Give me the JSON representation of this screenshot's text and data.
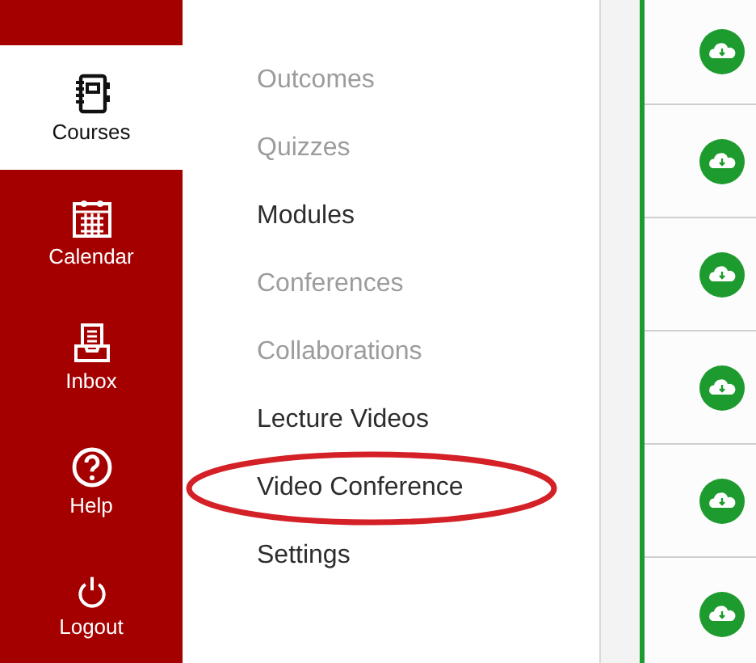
{
  "global_nav": [
    {
      "label": "Courses",
      "selected": true
    },
    {
      "label": "Calendar",
      "selected": false
    },
    {
      "label": "Inbox",
      "selected": false
    },
    {
      "label": "Help",
      "selected": false
    },
    {
      "label": "Logout",
      "selected": false
    }
  ],
  "course_nav": [
    {
      "label": "Outcomes",
      "disabled": true,
      "circled": false
    },
    {
      "label": "Quizzes",
      "disabled": true,
      "circled": false
    },
    {
      "label": "Modules",
      "disabled": false,
      "circled": false
    },
    {
      "label": "Conferences",
      "disabled": true,
      "circled": false
    },
    {
      "label": "Collaborations",
      "disabled": true,
      "circled": false
    },
    {
      "label": "Lecture Videos",
      "disabled": false,
      "circled": false
    },
    {
      "label": "Video Conference",
      "disabled": false,
      "circled": true
    },
    {
      "label": "Settings",
      "disabled": false,
      "circled": false
    }
  ],
  "module_rows": [
    {
      "published": true
    },
    {
      "published": true
    },
    {
      "published": true
    },
    {
      "published": true
    },
    {
      "published": true
    },
    {
      "published": true
    }
  ]
}
